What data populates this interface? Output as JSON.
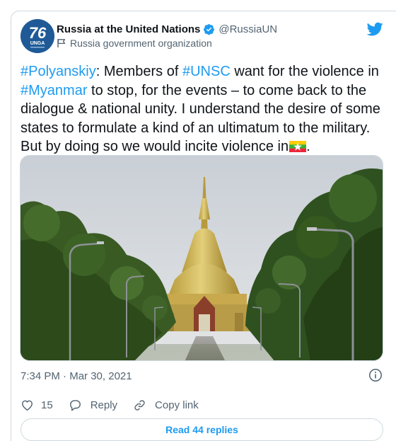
{
  "account": {
    "display_name": "Russia at the United Nations",
    "handle": "@RussiaUN",
    "label": "Russia government organization",
    "avatar_text": "76",
    "avatar_subtext": "UNGA",
    "avatar_color": "#1f5a97"
  },
  "tweet": {
    "segments": [
      {
        "text": "#Polyanskiy",
        "tag": true
      },
      {
        "text": ": Members of ",
        "tag": false
      },
      {
        "text": "#UNSC",
        "tag": true
      },
      {
        "text": " want for the violence in ",
        "tag": false
      },
      {
        "text": "#Myanmar",
        "tag": true
      },
      {
        "text": " to stop, for the events – to come back to the dialogue & national unity. I understand the desire of some states to formulate a kind of an ultimatum to the military. But by doing so we would incite violence in",
        "tag": false
      }
    ],
    "end_flag": "myanmar-flag",
    "end_punct": "."
  },
  "meta": {
    "time": "7:34 PM",
    "separator": " · ",
    "date": "Mar 30, 2021"
  },
  "actions": {
    "like_count": "15",
    "reply_label": "Reply",
    "copy_label": "Copy link"
  },
  "replies_button": "Read 44 replies",
  "colors": {
    "accent": "#1d9bf0",
    "text": "#0f1419",
    "secondary": "#536471",
    "border": "#cfd9de"
  }
}
